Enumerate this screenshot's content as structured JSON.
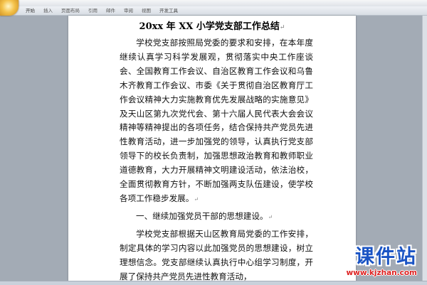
{
  "ribbon": {
    "tabs": [
      {
        "label": "开始"
      },
      {
        "label": "插入"
      },
      {
        "label": "页面布局"
      },
      {
        "label": "引用"
      },
      {
        "label": "邮件"
      },
      {
        "label": "审阅"
      },
      {
        "label": "视图"
      },
      {
        "label": "开发工具"
      }
    ]
  },
  "document": {
    "title": "20xx 年 XX 小学党支部工作总结",
    "paragraph_mark": "↵",
    "paragraphs": [
      "学校党支部按照局党委的要求和安排，在本年度继续认真学习科学发展观，贯彻落实中央工作座谈会、全国教育工作会议、自治区教育工作会议和乌鲁木齐教育工作会议、市委《关于贯彻自治区教育厅工作会议精神大力实施教育优先发展战略的实施意见》及天山区第九次党代会、第十六届人民代表大会会议精神等精神提出的各项任务，结合保持共产党员先进性教育活动，进一步加强党的领导，认真执行党支部领导下的校长负责制，加强思想政治教育和教师职业道德教育，大力开展精神文明建设活动，依法治校，全面贯彻教育方针，不断加强两支队伍建设，使学校各项工作稳步发展。",
      "一、继续加强党员干部的思想建设。",
      "学校党支部根据天山区教育局党委的工作安排，制定具体的学习内容以此加强党员的思想建设，树立理想信念。党支部继续认真执行中心组学习制度，开展了保持共产党员先进性教育活动，"
    ]
  },
  "watermark": {
    "main": "课件站",
    "url": "www.kjzhan.com"
  },
  "colors": {
    "watermark_main": "#1a54c4",
    "watermark_url": "#d22222",
    "page": "#ffffff",
    "workspace": "#a3abb5"
  }
}
